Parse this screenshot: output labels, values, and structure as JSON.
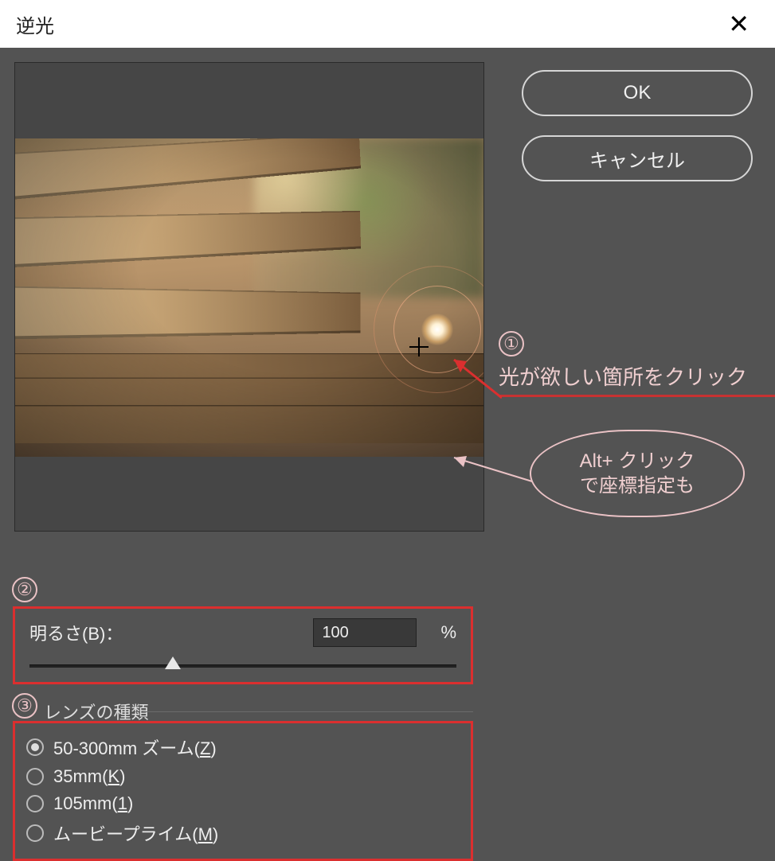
{
  "dialog": {
    "title": "逆光",
    "ok_label": "OK",
    "cancel_label": "キャンセル"
  },
  "annotations": {
    "step1_num": "①",
    "step1_text": "光が欲しい箇所をクリック",
    "bubble_line1": "Alt+ クリック",
    "bubble_line2": "で座標指定も",
    "step2_num": "②",
    "step3_num": "③"
  },
  "brightness": {
    "label": "明るさ(B)：",
    "value": "100",
    "unit": "%"
  },
  "lens": {
    "heading": "レンズの種類",
    "options": [
      {
        "label_pre": "50-300mm ズーム(",
        "hotkey": "Z",
        "label_post": ")",
        "checked": true
      },
      {
        "label_pre": "35mm(",
        "hotkey": "K",
        "label_post": ")",
        "checked": false
      },
      {
        "label_pre": "105mm(",
        "hotkey": "1",
        "label_post": ")",
        "checked": false
      },
      {
        "label_pre": "ムービープライム(",
        "hotkey": "M",
        "label_post": ")",
        "checked": false
      }
    ]
  }
}
